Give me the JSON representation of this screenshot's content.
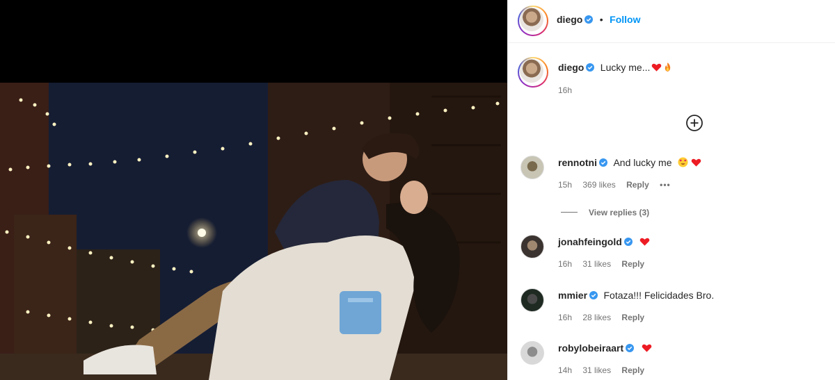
{
  "post": {
    "author": "diego",
    "follow_label": "Follow",
    "separator": "•",
    "caption": {
      "username": "diego",
      "text": "Lucky me...",
      "emojis": [
        "heart",
        "fire"
      ],
      "time": "16h"
    }
  },
  "load_more_icon": "plus-circle-icon",
  "comments": [
    {
      "username": "rennotni",
      "verified": true,
      "text": "And lucky me",
      "emojis": [
        "heart-eyes",
        "heart"
      ],
      "time": "15h",
      "likes": "369 likes",
      "reply": "Reply",
      "more": "•••",
      "view_replies": "View replies (3)"
    },
    {
      "username": "jonahfeingold",
      "verified": true,
      "text": "",
      "emojis": [
        "heart"
      ],
      "time": "16h",
      "likes": "31 likes",
      "reply": "Reply"
    },
    {
      "username": "mmier",
      "verified": true,
      "text": "Fotaza!!! Felicidades Bro.",
      "emojis": [],
      "time": "16h",
      "likes": "28 likes",
      "reply": "Reply"
    },
    {
      "username": "robylobeiraart",
      "verified": true,
      "text": "",
      "emojis": [
        "heart"
      ],
      "time": "14h",
      "likes": "31 likes",
      "reply": "Reply"
    }
  ],
  "colors": {
    "accent": "#0095f6",
    "heart": "#ed1c24",
    "verified": "#3897f0",
    "meta": "#737373"
  }
}
